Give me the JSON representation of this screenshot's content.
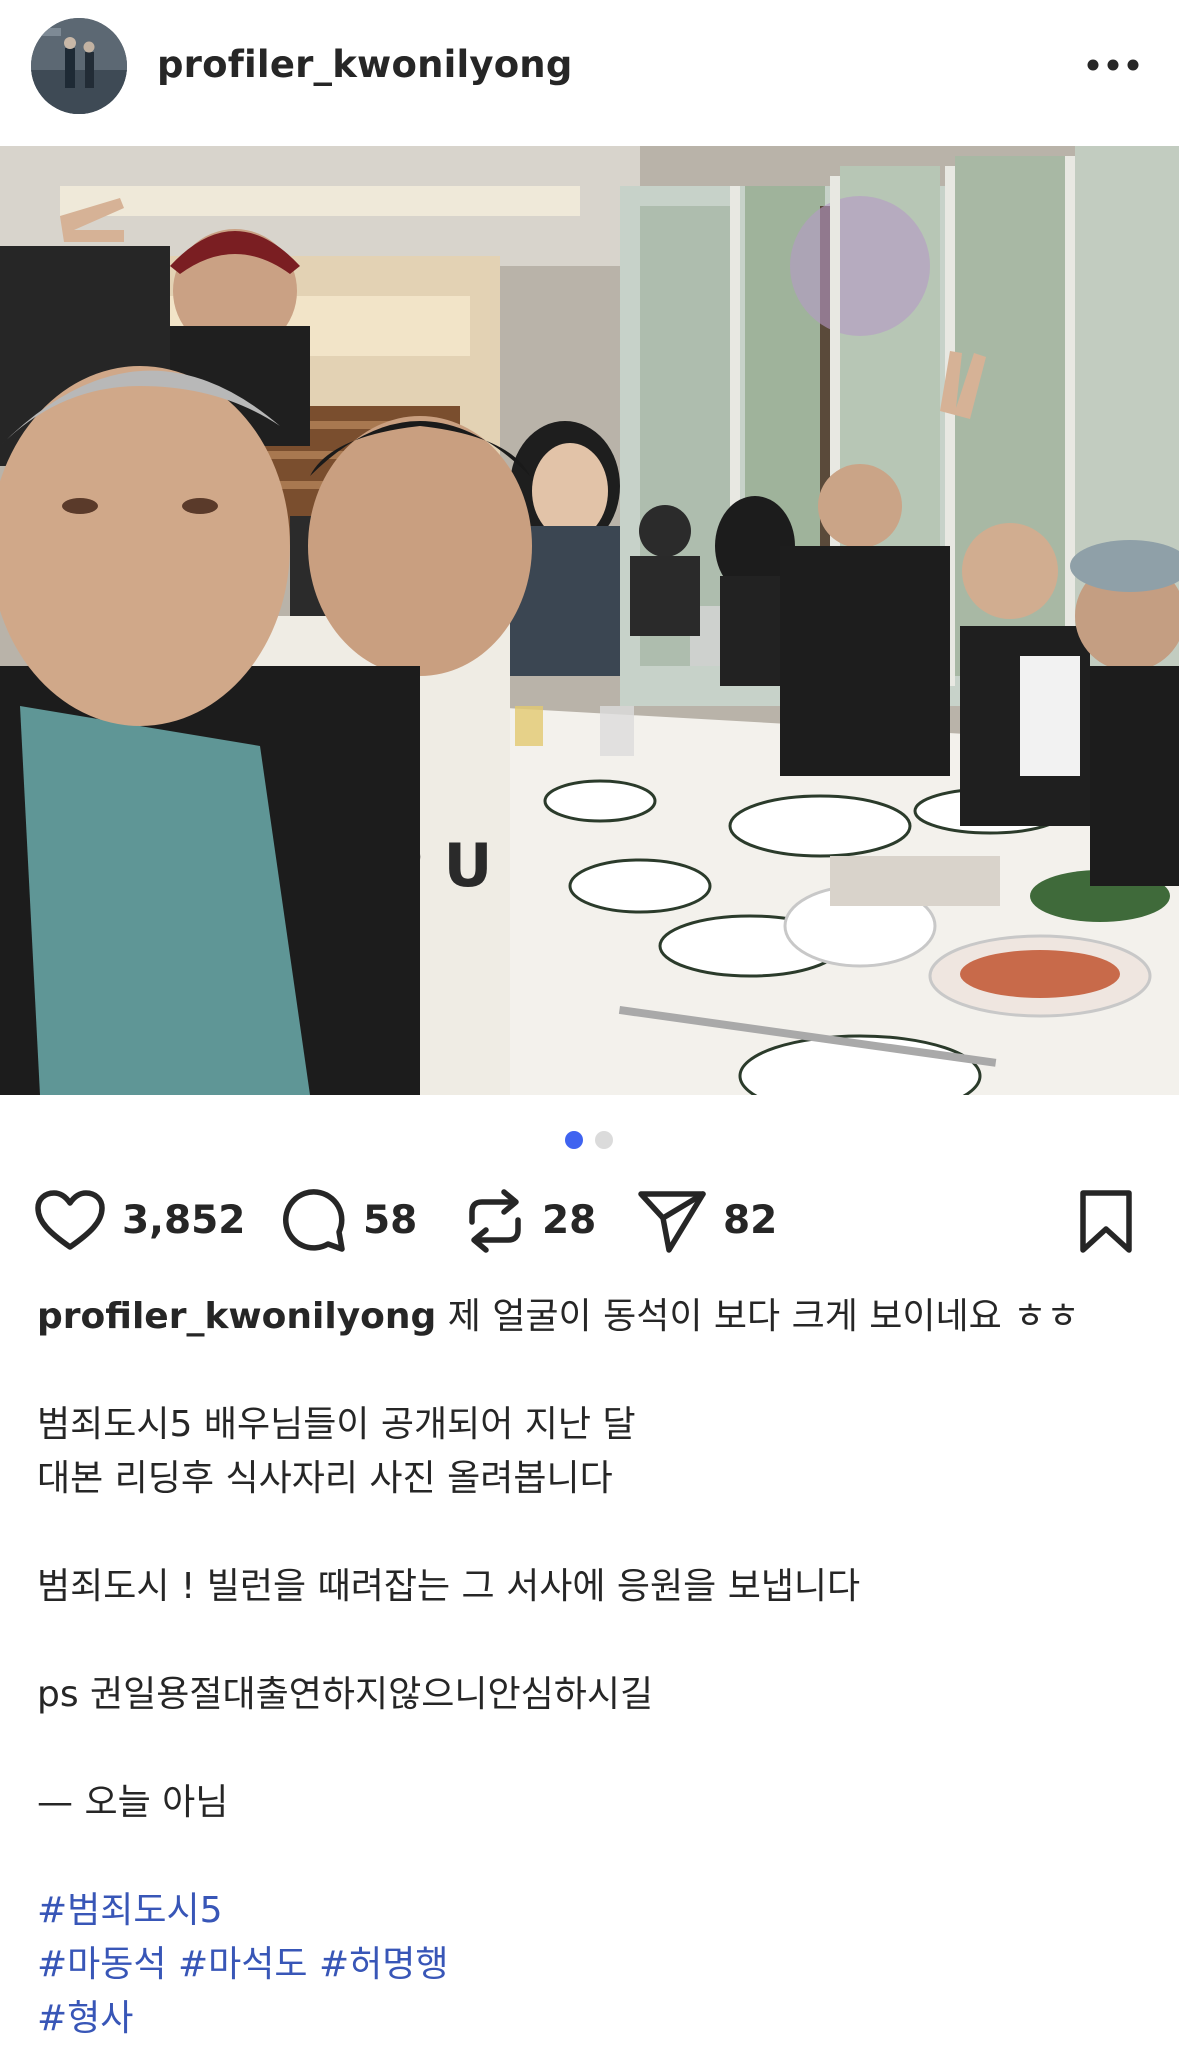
{
  "post": {
    "username": "profiler_kwonilyong"
  },
  "actions": {
    "likes": "3,852",
    "comments": "58",
    "reposts": "28",
    "shares": "82"
  },
  "carousel": {
    "current": 1,
    "total": 2
  },
  "caption": {
    "username": "profiler_kwonilyong",
    "first_line": "제 얼굴이 동석이 보다 크게 보이네요 ㅎㅎ",
    "line2": "범죄도시5 배우님들이 공개되어 지난 달",
    "line3": "대본 리딩후 식사자리 사진 올려봅니다",
    "line4": "범죄도시 !  빌런을 때려잡는 그 서사에 응원을 보냅니다",
    "line5": "ps  권일용절대출연하지않으니안심하시길",
    "line6": "— 오늘 아님"
  },
  "hashtags": {
    "h1": "#범죄도시5",
    "h2": "#마동석",
    "h3": "#마석도",
    "h4": "#허명행",
    "h5": "#형사"
  },
  "icons": {
    "more": "more-horizontal-icon",
    "like": "heart-icon",
    "comment": "comment-bubble-icon",
    "repost": "repost-icon",
    "share": "send-icon",
    "bookmark": "bookmark-icon"
  },
  "colors": {
    "accent_dot": "#3f63f0",
    "hashtag": "#3856b7",
    "text": "#262626"
  }
}
